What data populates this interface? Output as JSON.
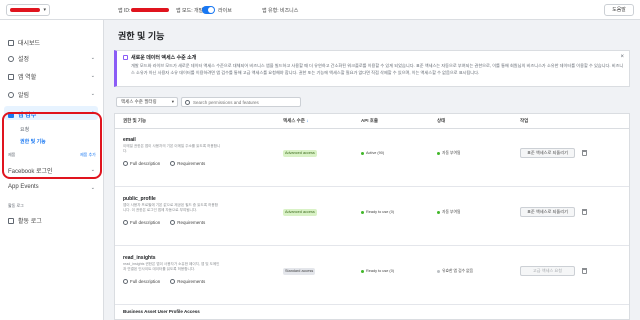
{
  "topbar": {
    "app_id_label": "앱 ID:",
    "app_mode_label": "앱 모드: 개발",
    "app_mode_live": "라이브",
    "app_type": "앱 유형: 비즈니스",
    "help": "도움말"
  },
  "sidebar": {
    "items": [
      {
        "label": "대시보드"
      },
      {
        "label": "설정"
      },
      {
        "label": "앱 역할"
      },
      {
        "label": "알림"
      },
      {
        "label": "앱 검수"
      }
    ],
    "sub_items": [
      {
        "label": "요청"
      },
      {
        "label": "권한 및 기능"
      }
    ],
    "small_left": "제품",
    "small_right": "제품 추가",
    "products": [
      {
        "label": "Facebook 로그인"
      },
      {
        "label": "App Events"
      }
    ],
    "activity_small": "활동 로그",
    "activity": "활동 로그"
  },
  "main": {
    "title": "권한 및 기능",
    "banner": {
      "title": "새로운 데이터 액세스 수준 소개",
      "text": "개발 모드와 라이브 모드가 새로운 데이터 액세스 수준으로 대체되어 비즈니스 앱을 빌드하고 사용할 때 더 유연하고 간소화된 워크플로를 이용할 수 있게 되었습니다. 표준 액세스는 자동으로 부여되는 권한으로, 이를 통해 회원님의 비즈니스가 소유한 데이터를 이용할 수 있습니다. 비즈니스 소유가 아닌 사용자 소유 데이터를 이용하려면 앱 검수를 통해 고급 액세스를 요청해야 합니다. 권한 또는 기능에 액세스할 필요가 없다면 직접 삭제할 수 있으며, 이는 액세스할 수 없음으로 표시됩니다."
    },
    "filter_label": "액세스 수준 필터링",
    "search_placeholder": "Search permissions and features",
    "columns": [
      "권한 및 기능",
      "액세스 수준",
      "API 호출",
      "상태",
      "작업"
    ],
    "rows": [
      {
        "name": "email",
        "desc": "이메일 권한은 앱이 사용자의 기본 이메일 주소를 읽도록 허용합니다.",
        "level": "Advanced access",
        "api": "Active (90)",
        "api_color": "#42b72a",
        "status": "자동 부여됨",
        "action": "표준 액세스로 되돌리기",
        "full_desc": "Full description",
        "requirements": "Requirements"
      },
      {
        "name": "public_profile",
        "desc": "앱이 사용자 프로필에 기본 값으로 제공된 필드 중 읽도록 허용합니다. 이 권한은 로그인 앱에 자동으로 부여됩니다.",
        "level": "Advanced access",
        "api": "Ready to use (0)",
        "api_color": "#42b72a",
        "status": "자동 부여됨",
        "action": "표준 액세스로 되돌리기",
        "full_desc": "Full description",
        "requirements": "Requirements"
      },
      {
        "name": "read_insights",
        "desc": "read_insights 권한은 앱이 사용자가 소유한 페이지, 앱 및 도메인과 연결된 인사이트 데이터를 읽도록 허용합니다.",
        "level": "Standard access",
        "api": "Ready to use (0)",
        "api_color": "#42b72a",
        "status": "유효한 앱 검수 없음",
        "action": "고급 액세스 요청",
        "full_desc": "Full description",
        "requirements": "Requirements"
      }
    ],
    "last_row_name": "Business Asset User Profile Access"
  }
}
